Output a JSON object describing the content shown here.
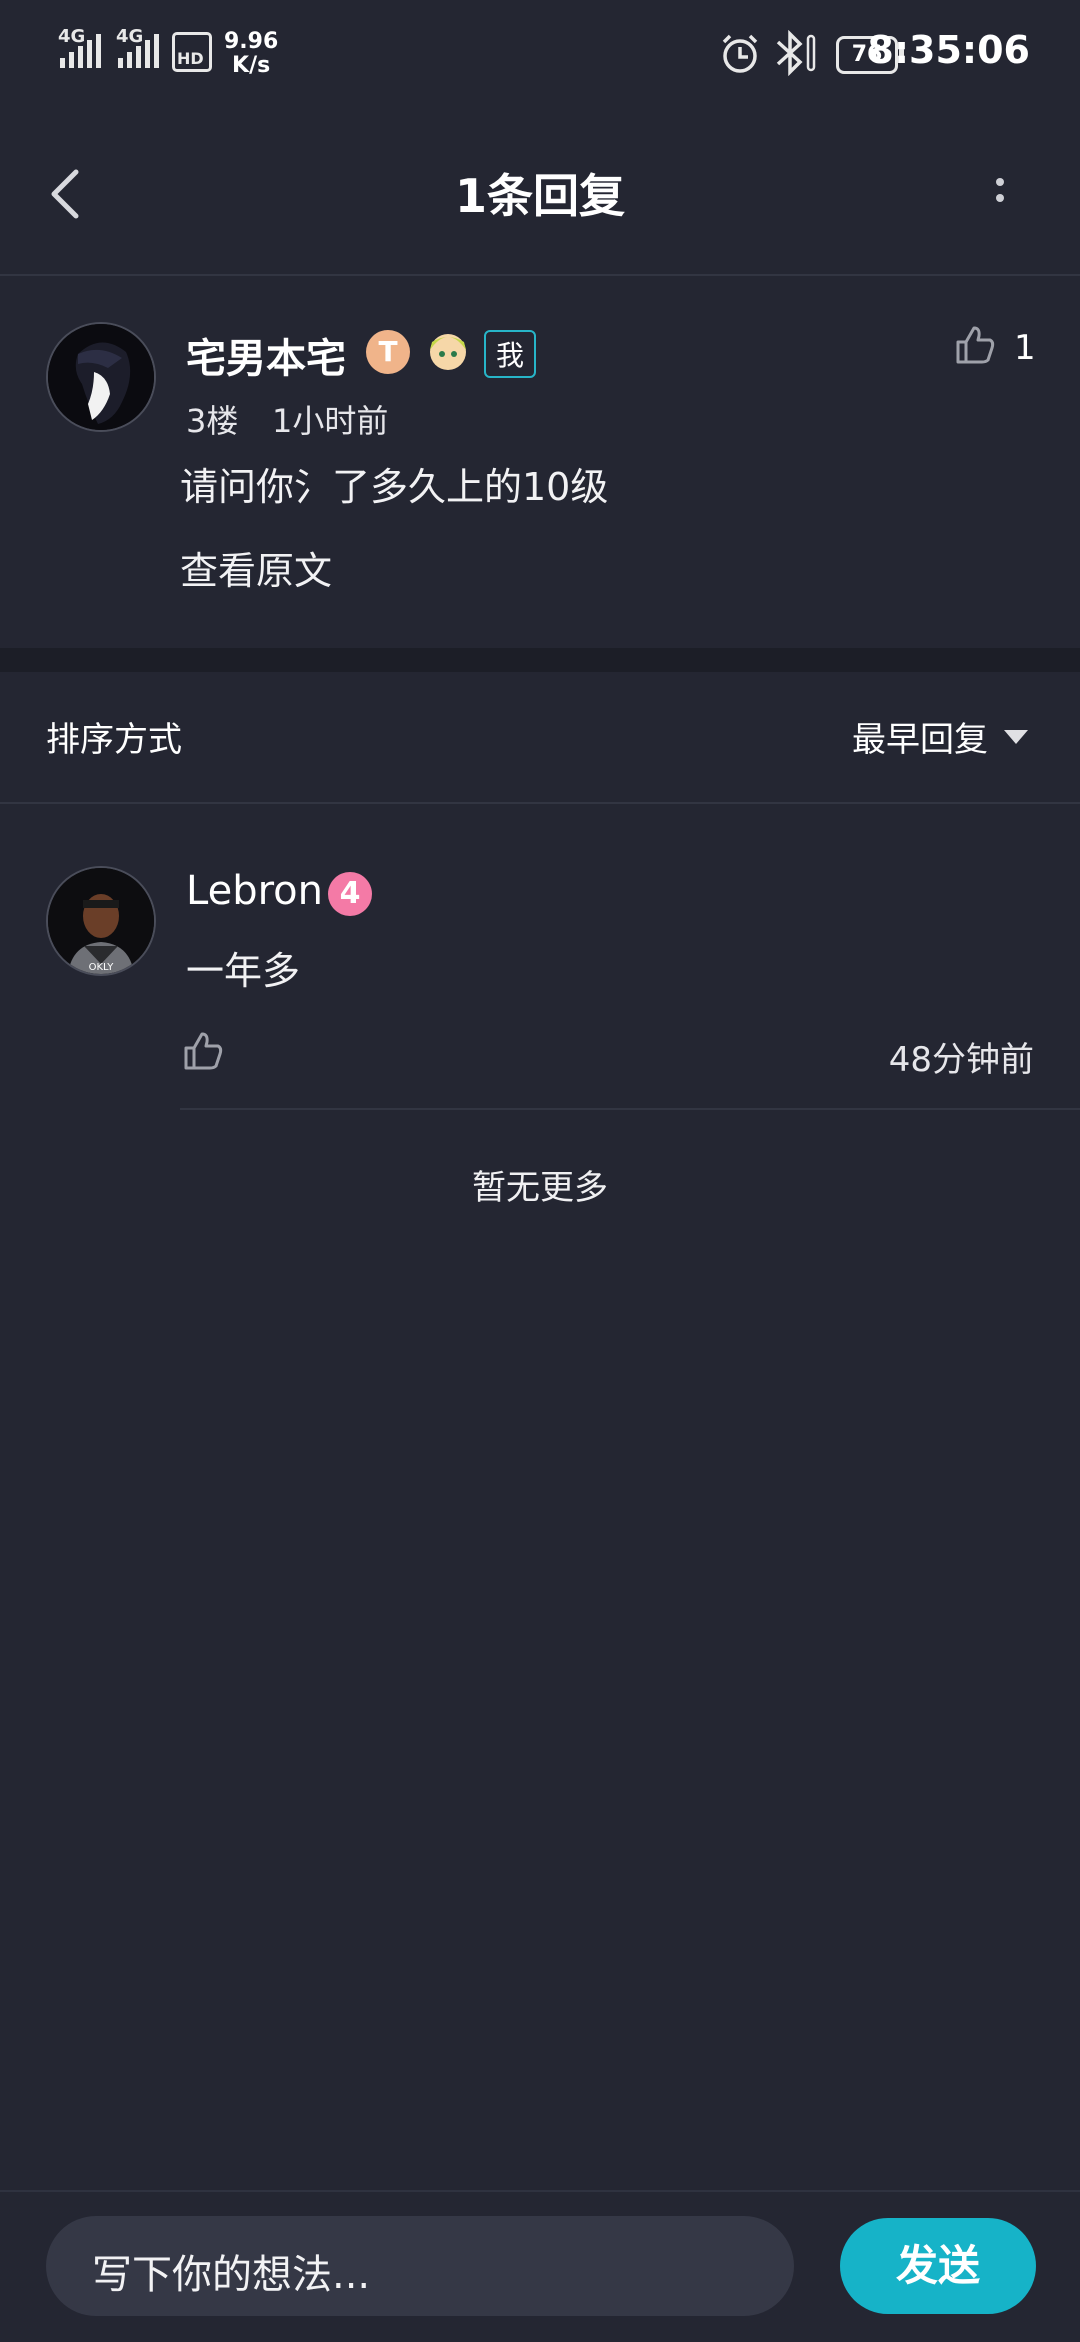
{
  "status_bar": {
    "signal1": "4G",
    "signal2": "4G",
    "hd": "HD",
    "net_speed_value": "9.96",
    "net_speed_unit": "K/s",
    "battery": "76",
    "time": "8:35:06"
  },
  "header": {
    "title": "1条回复"
  },
  "main_comment": {
    "author": "宅男本宅",
    "badge_letter": "T",
    "me_tag": "我",
    "floor": "3楼",
    "time": "1小时前",
    "content": "请问你氵了多久上的10级",
    "view_original": "查看原文",
    "likes": "1"
  },
  "sort": {
    "label": "排序方式",
    "value": "最早回复"
  },
  "replies": [
    {
      "author": "Lebron",
      "level": "4",
      "content": "一年多",
      "time": "48分钟前"
    }
  ],
  "footer_text": "暂无更多",
  "bottom_bar": {
    "input_placeholder": "写下你的想法...",
    "send_label": "发送"
  },
  "colors": {
    "background": "#242632",
    "accent": "#16b3c8",
    "level_badge": "#f47aa6"
  }
}
